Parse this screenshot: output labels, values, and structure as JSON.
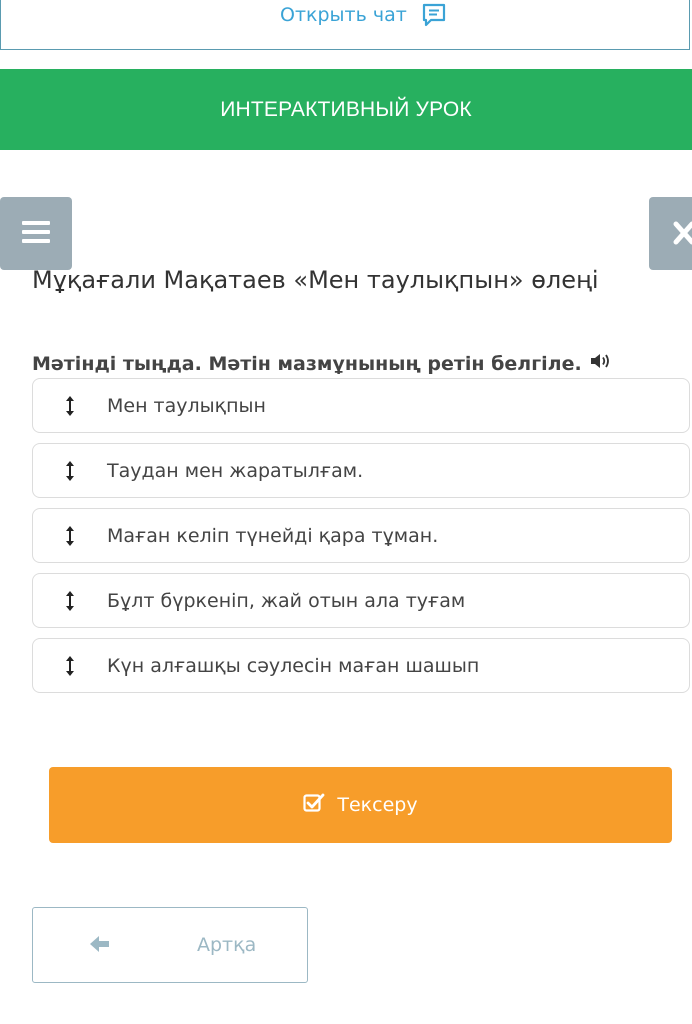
{
  "chat": {
    "label": "Открыть чат",
    "icon": "chat-icon"
  },
  "banner": {
    "title": "ИНТЕРАКТИВНЫЙ УРОК"
  },
  "controls": {
    "menu_icon": "hamburger-icon",
    "close_icon": "close-icon"
  },
  "lesson": {
    "title": "Мұқағали Мақатаев «Мен таулықпын» өлеңі",
    "instruction": "Мәтінді тыңда. Мәтін мазмұнының ретін белгіле.",
    "instruction_icon": "speaker-icon",
    "items": [
      {
        "label": "Мен таулықпын"
      },
      {
        "label": "Таудан мен жаратылғам."
      },
      {
        "label": "Маған келіп түнейді қара тұман."
      },
      {
        "label": "Бұлт бүркеніп, жай отын ала туғам"
      },
      {
        "label": "Күн алғашқы сәулесін маған шашып"
      }
    ]
  },
  "actions": {
    "check_label": "Тексеру",
    "back_label": "Артқа"
  },
  "colors": {
    "banner": "#27b05f",
    "check": "#f79d2a",
    "link": "#3aa3d6",
    "control": "#9cacb5"
  }
}
